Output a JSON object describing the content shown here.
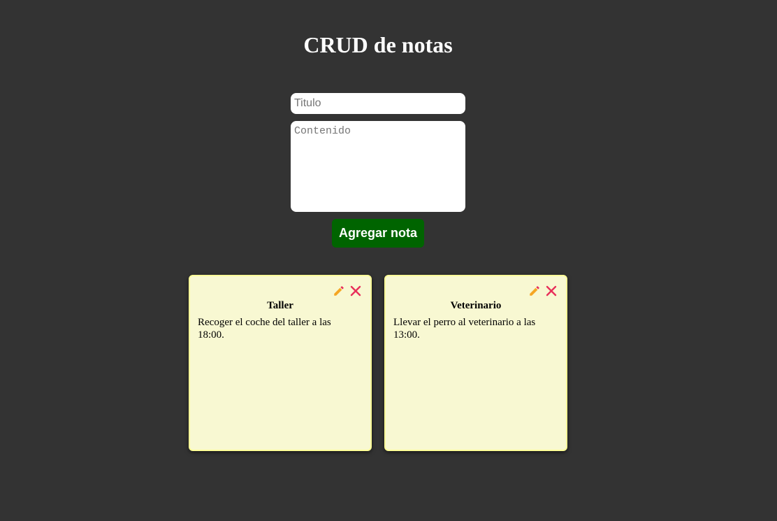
{
  "header": {
    "title": "CRUD de notas"
  },
  "form": {
    "title_placeholder": "Titulo",
    "title_value": "",
    "content_placeholder": "Contenido",
    "content_value": "",
    "add_button_label": "Agregar nota"
  },
  "notes": [
    {
      "title": "Taller",
      "content": "Recoger el coche del taller a las 18:00.",
      "edit_icon": "pencil-icon",
      "delete_icon": "close-icon"
    },
    {
      "title": "Veterinario",
      "content": "Llevar el perro al veterinario a las 13:00.",
      "edit_icon": "pencil-icon",
      "delete_icon": "close-icon"
    }
  ],
  "colors": {
    "background": "#333333",
    "button": "#006400",
    "note_background": "#f8f8d2",
    "note_border": "#ffff99",
    "edit_icon": "#f5a623",
    "delete_icon": "#e8305a"
  }
}
